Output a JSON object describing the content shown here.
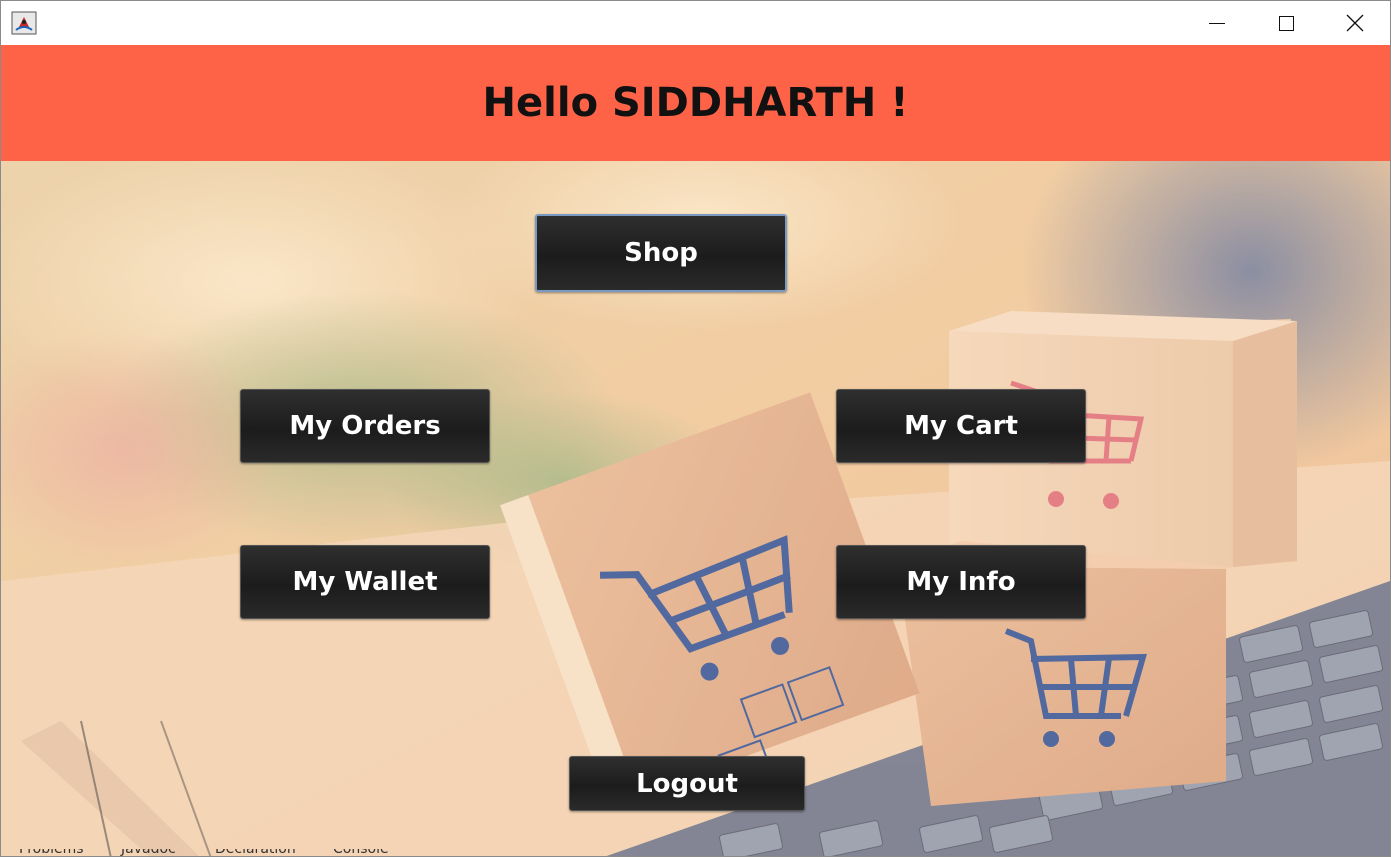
{
  "window": {
    "icons": {
      "app": "java-app-icon",
      "minimize": "minimize-icon",
      "maximize": "maximize-icon",
      "close": "close-icon"
    }
  },
  "header": {
    "greeting": "Hello SIDDHARTH !",
    "background_color": "#ff6347"
  },
  "buttons": {
    "shop": "Shop",
    "my_orders": "My Orders",
    "my_cart": "My Cart",
    "my_wallet": "My Wallet",
    "my_info": "My Info",
    "logout": "Logout"
  },
  "background": {
    "image": "laptop-keyboard-with-shopping-cart-boxes"
  },
  "ide_tabs": [
    "Problems",
    "Javadoc",
    "Declaration",
    "Console"
  ]
}
